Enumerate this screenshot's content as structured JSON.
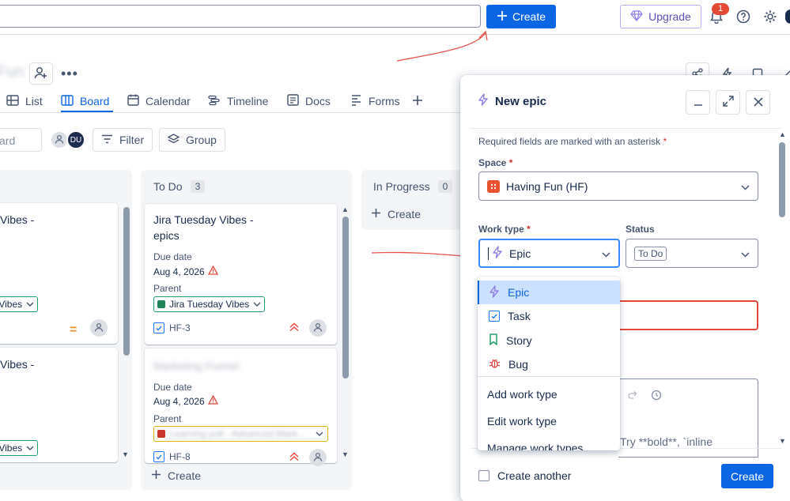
{
  "topbar": {
    "create_label": "Create",
    "upgrade_label": "Upgrade",
    "notification_count": "1"
  },
  "project": {
    "title_blurred": "Fun"
  },
  "tabs": [
    {
      "label": "List"
    },
    {
      "label": "Board"
    },
    {
      "label": "Calendar"
    },
    {
      "label": "Timeline"
    },
    {
      "label": "Docs"
    },
    {
      "label": "Forms"
    }
  ],
  "filters": {
    "search_placeholder": "ard",
    "avatar_initials": "DU",
    "filter_label": "Filter",
    "group_label": "Group"
  },
  "board": {
    "left_column": {
      "card1_title": "Vibes -",
      "card1_parent": "y Vibes",
      "card2_title": "Vibes -",
      "card2_parent": "y Vibes"
    },
    "todo": {
      "title": "To Do",
      "count": "3",
      "card1": {
        "title": "Jira Tuesday Vibes - epics",
        "due_label": "Due date",
        "due_value": "Aug 4, 2026",
        "parent_label": "Parent",
        "parent_value": "Jira Tuesday Vibes",
        "key": "HF-3"
      },
      "card2": {
        "title_blurred": "Marketing Funnel",
        "due_label": "Due date",
        "due_value": "Aug 4, 2026",
        "parent_label": "Parent",
        "parent_blurred": "Learning poll - Advanced Mark...",
        "key": "HF-8"
      },
      "create_label": "Create"
    },
    "in_progress": {
      "title": "In Progress",
      "count": "0",
      "create_label": "Create"
    }
  },
  "modal": {
    "title": "New epic",
    "required_note": "Required fields are marked with an asterisk",
    "space_label": "Space",
    "space_value": "Having Fun (HF)",
    "work_type_label": "Work type",
    "work_type_value": "Epic",
    "status_label": "Status",
    "status_value": "To Do",
    "description_placeholder": "Try **bold**, `inline",
    "create_another_label": "Create another",
    "create_label": "Create"
  },
  "dropdown": {
    "options": [
      {
        "label": "Epic"
      },
      {
        "label": "Task"
      },
      {
        "label": "Story"
      },
      {
        "label": "Bug"
      }
    ],
    "actions": [
      {
        "label": "Add work type"
      },
      {
        "label": "Edit work type"
      },
      {
        "label": "Manage work types"
      }
    ]
  },
  "colors": {
    "primary": "#0c66e4",
    "epic": "#8f7ee7",
    "task": "#1d7afc",
    "story": "#22a06b",
    "bug": "#e2483d",
    "annotation": "#e5534b"
  }
}
